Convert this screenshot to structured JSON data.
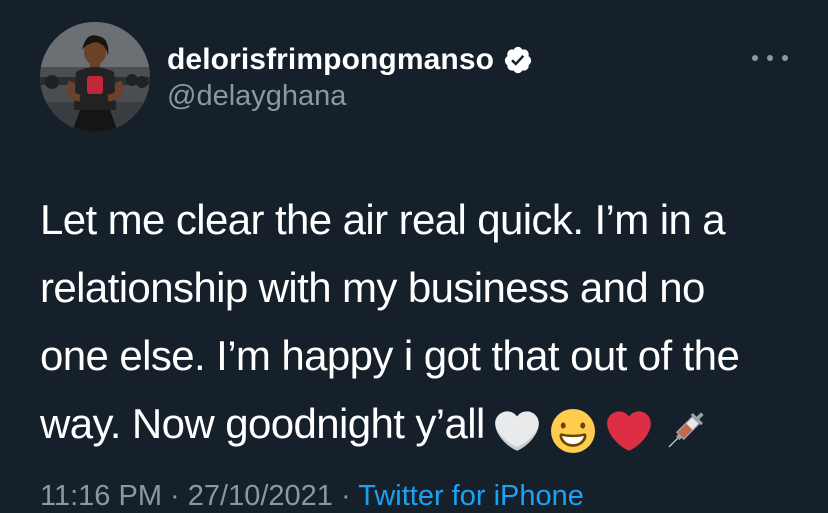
{
  "user": {
    "display_name": "delorisfrimpongmanso",
    "handle": "@delayghana",
    "verified": true
  },
  "tweet": {
    "lines": [
      "Let me clear the air real quick. I’m in a",
      "relationship with my business and no",
      "one else. I’m happy i got that out of the",
      "way. Now goodnight y’all"
    ],
    "emojis": [
      "white-heart-icon",
      "grinning-face-icon",
      "red-heart-icon",
      "syringe-icon"
    ]
  },
  "meta": {
    "time": "11:16 PM",
    "separator": "·",
    "date": "27/10/2021",
    "source": "Twitter for iPhone"
  },
  "colors": {
    "background": "#15202b",
    "text": "#ffffff",
    "secondary": "#8899a6",
    "accent": "#1da1f2"
  }
}
